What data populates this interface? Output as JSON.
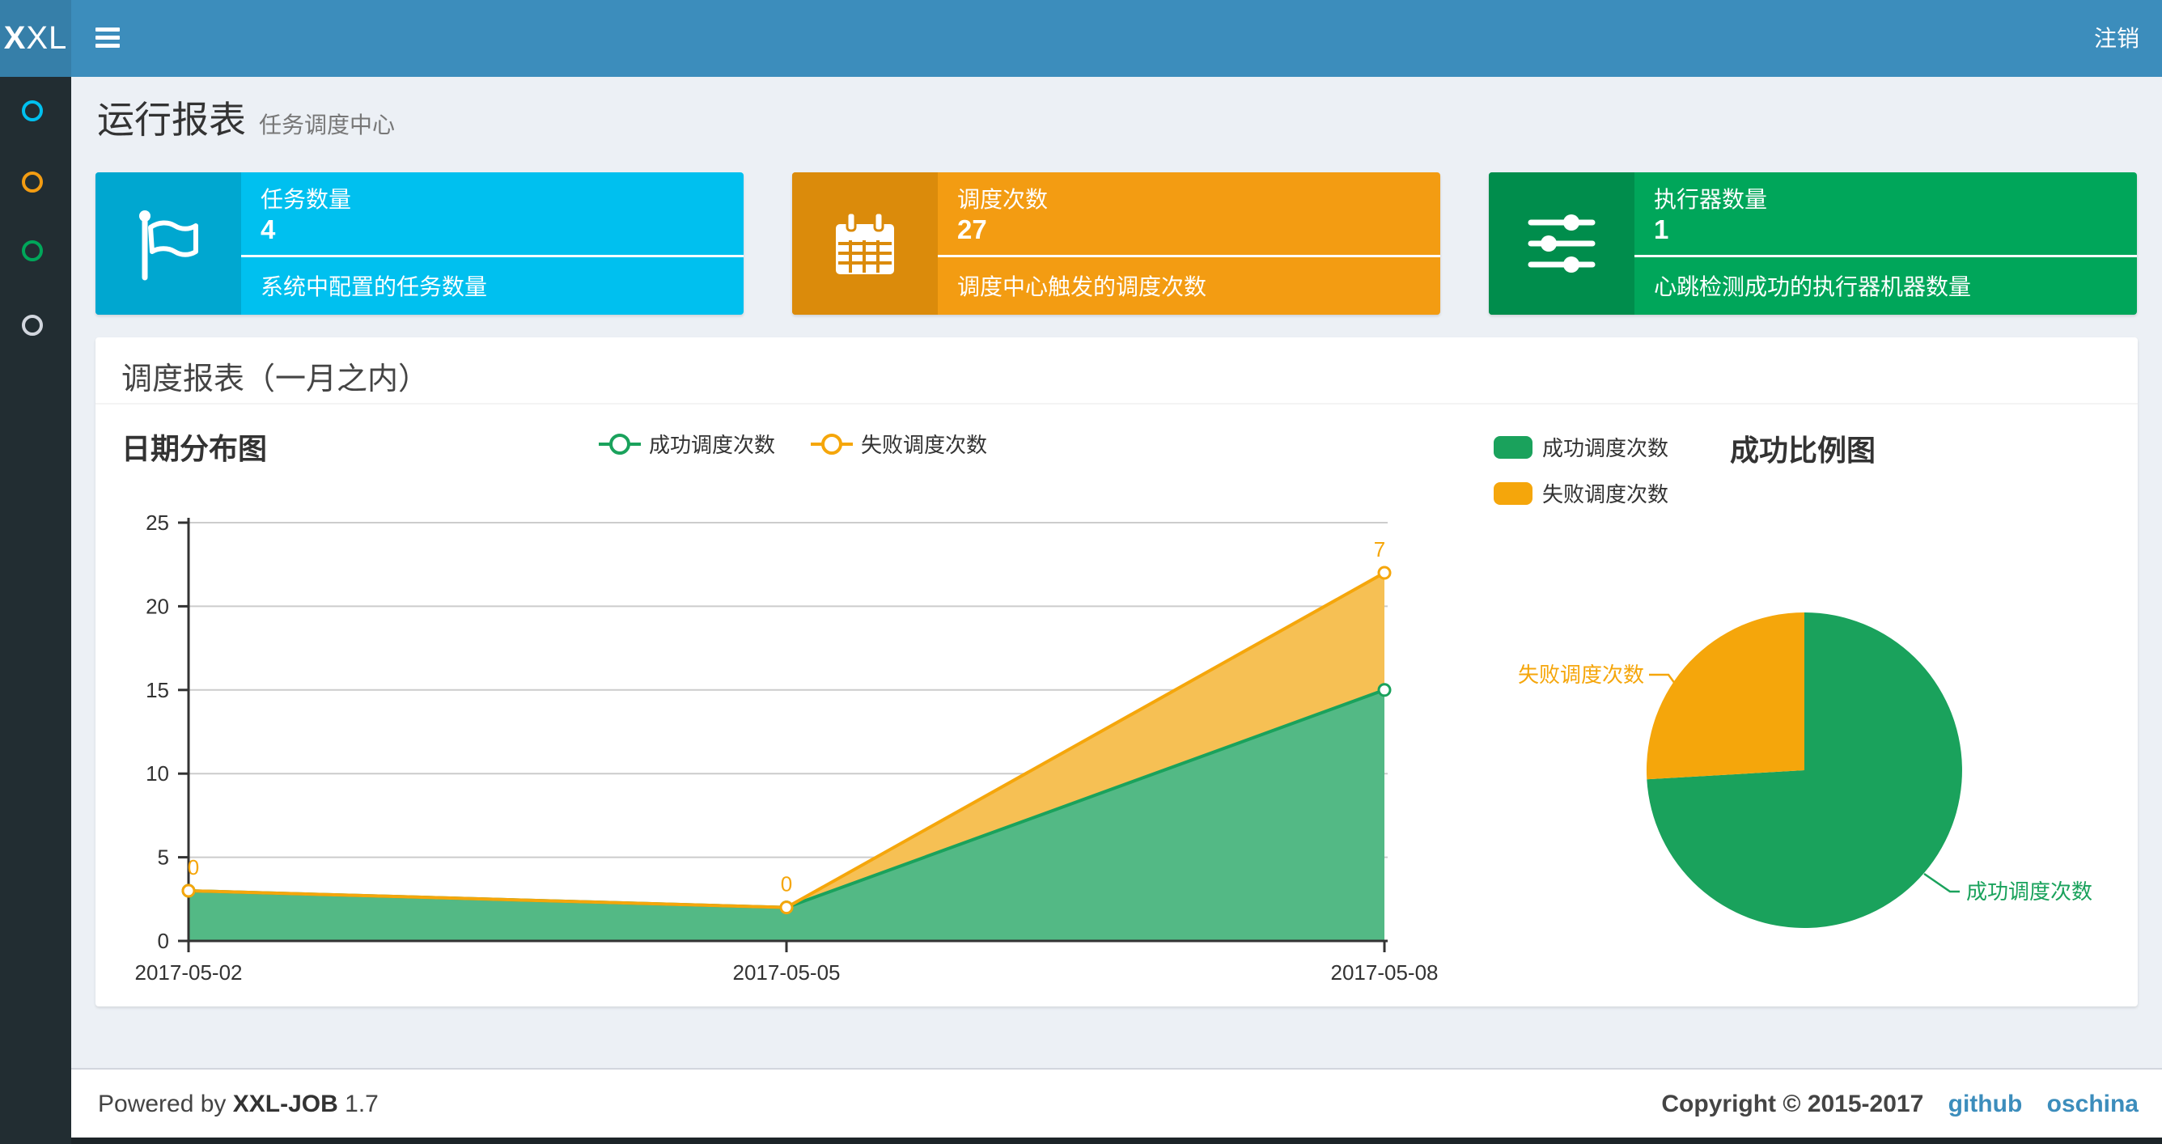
{
  "navbar": {
    "logo_bold": "X",
    "logo_rest": "XL",
    "logout_label": "注销"
  },
  "sidebar": {
    "items": [
      {
        "icon": "circle-o-icon",
        "color": "#00c0ef"
      },
      {
        "icon": "circle-o-icon",
        "color": "#f39c12"
      },
      {
        "icon": "circle-o-icon",
        "color": "#00a65a"
      },
      {
        "icon": "circle-o-icon",
        "color": "#d2d6de"
      }
    ]
  },
  "page_header": {
    "title": "运行报表",
    "subtitle": "任务调度中心"
  },
  "stat_boxes": [
    {
      "label": "任务数量",
      "value": "4",
      "description": "系统中配置的任务数量",
      "color": "#00c0ef",
      "icon_bg": "#00a7d0",
      "icon": "flag-icon"
    },
    {
      "label": "调度次数",
      "value": "27",
      "description": "调度中心触发的调度次数",
      "color": "#f39c12",
      "icon_bg": "#db8b0b",
      "icon": "calendar-icon"
    },
    {
      "label": "执行器数量",
      "value": "1",
      "description": "心跳检测成功的执行器机器数量",
      "color": "#00a65a",
      "icon_bg": "#008d4c",
      "icon": "sliders-icon"
    }
  ],
  "panel": {
    "title": "调度报表（一月之内）"
  },
  "chart_data": [
    {
      "type": "area",
      "title": "日期分布图",
      "x": [
        "2017-05-02",
        "2017-05-05",
        "2017-05-08"
      ],
      "series": [
        {
          "name": "成功调度次数",
          "values": [
            3,
            2,
            15
          ],
          "color": "#1aa25c",
          "area_color": "#53b985"
        },
        {
          "name": "失败调度次数",
          "values": [
            0,
            0,
            7
          ],
          "color": "#f5a60b",
          "area_color": "#f6c054"
        }
      ],
      "stacked": true,
      "ylim": [
        0,
        25
      ],
      "ytick_step": 5,
      "grid": true,
      "legend_position": "top-center",
      "point_labels": {
        "series": "失败调度次数",
        "values": [
          0,
          0,
          7
        ],
        "color": "#f5a60b"
      }
    },
    {
      "type": "pie",
      "title": "成功比例图",
      "slices": [
        {
          "name": "成功调度次数",
          "value": 20,
          "color": "#1aa25c"
        },
        {
          "name": "失败调度次数",
          "value": 7,
          "color": "#f5a60b"
        }
      ],
      "legend_position": "top-left"
    }
  ],
  "footer": {
    "powered_prefix": "Powered by ",
    "brand": "XXL-JOB",
    "version": " 1.7",
    "copyright": "Copyright © 2015-2017",
    "links": [
      "github",
      "oschina"
    ]
  }
}
